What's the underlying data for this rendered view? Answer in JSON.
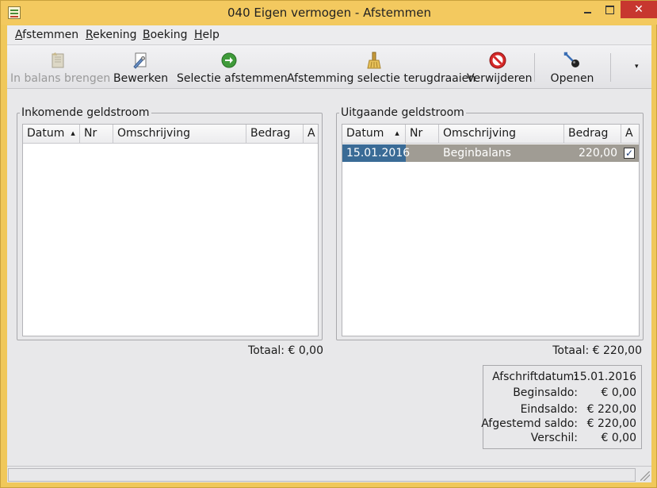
{
  "window": {
    "title": "040 Eigen vermogen - Afstemmen",
    "close_label": "✕"
  },
  "menu": [
    {
      "first": "A",
      "rest": "fstemmen"
    },
    {
      "first": "R",
      "rest": "ekening"
    },
    {
      "first": "B",
      "rest": "oeking"
    },
    {
      "first": "H",
      "rest": "elp"
    }
  ],
  "toolbar": {
    "balance_label": "In balans brengen",
    "edit_label": "Bewerken",
    "reconcile_label": "Selectie afstemmen",
    "undo_label": "Afstemming selectie terugdraaien",
    "delete_label": "Verwijderen",
    "open_label": "Openen",
    "overflow": "▾"
  },
  "incoming": {
    "title": "Inkomende geldstroom",
    "columns": [
      "Datum",
      "Nr",
      "Omschrijving",
      "Bedrag",
      "A"
    ],
    "sort_indicator": "▲",
    "rows": [],
    "total": "Totaal:  € 0,00"
  },
  "outgoing": {
    "title": "Uitgaande geldstroom",
    "columns": [
      "Datum",
      "Nr",
      "Omschrijving",
      "Bedrag",
      "A"
    ],
    "sort_indicator": "▲",
    "rows": [
      {
        "date": "15.01.2016",
        "nr": "",
        "description": "Beginbalans",
        "amount": "220,00",
        "reconciled": "✓"
      }
    ],
    "total": "Totaal:  € 220,00"
  },
  "summary": {
    "statement_date_label": "Afschriftdatum:",
    "statement_date": "15.01.2016",
    "opening_label": "Beginsaldo:",
    "opening": "€ 0,00",
    "closing_label": "Eindsaldo:",
    "closing": "€ 220,00",
    "reconciled_label": "Afgestemd saldo:",
    "reconciled": "€ 220,00",
    "difference_label": "Verschil:",
    "difference": "€ 0,00"
  }
}
